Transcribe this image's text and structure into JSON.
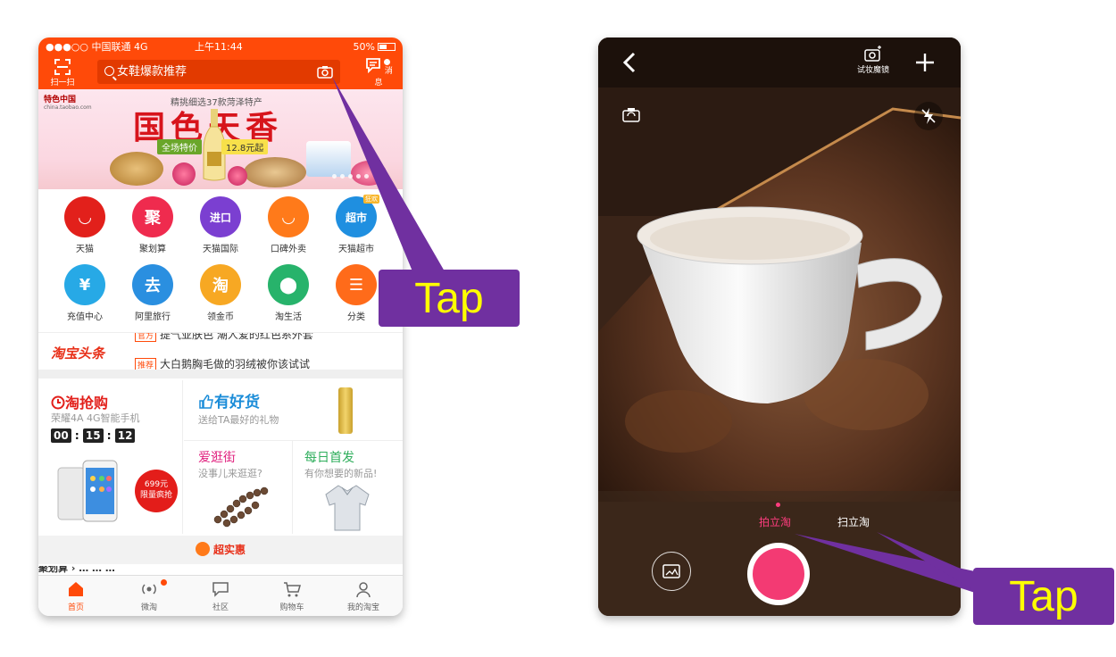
{
  "left_phone": {
    "status_bar": {
      "carrier": "●●●○○ 中国联通  4G",
      "time": "上午11:44",
      "battery": "50%"
    },
    "header": {
      "scan_label": "扫一扫",
      "search_placeholder": "女鞋爆款推荐",
      "messages_label": "消息"
    },
    "banner": {
      "brand": "特色中国",
      "top_text": "精挑细选37款菏泽特产",
      "title": "国色天香",
      "tag_left": "全场特价",
      "tag_right": "12.8元起"
    },
    "icons": [
      {
        "label": "天猫",
        "glyph": "◡",
        "color": "#e2201b",
        "icon": "tmall-icon"
      },
      {
        "label": "聚划算",
        "glyph": "聚",
        "color": "#ef2b4e",
        "icon": "juhuasuan-icon"
      },
      {
        "label": "天猫国际",
        "glyph": "进口",
        "color": "#7b3fd1",
        "icon": "tmall-global-icon"
      },
      {
        "label": "口碑外卖",
        "glyph": "◡",
        "color": "#ff7a1a",
        "icon": "koubei-icon"
      },
      {
        "label": "天猫超市",
        "glyph": "超市",
        "color": "#1f8fe0",
        "icon": "tmall-supermarket-icon",
        "badge": "狂欢"
      },
      {
        "label": "充值中心",
        "glyph": "¥",
        "color": "#27a9e6",
        "icon": "recharge-icon"
      },
      {
        "label": "阿里旅行",
        "glyph": "去",
        "color": "#2a8fe0",
        "icon": "travel-icon"
      },
      {
        "label": "领金币",
        "glyph": "淘",
        "color": "#f7a823",
        "icon": "gold-coin-icon"
      },
      {
        "label": "淘生活",
        "glyph": "⬤",
        "color": "#27b36b",
        "icon": "location-icon"
      },
      {
        "label": "分类",
        "glyph": "☰",
        "color": "#ff6b1a",
        "icon": "category-icon"
      }
    ],
    "headline": {
      "logo": "淘宝头条",
      "line1_tag": "官方",
      "line1": "提气亚肤色 潮人爱的红色系外套",
      "line2_tag": "推荐",
      "line2": "大白鹅胸毛做的羽绒被你该试试"
    },
    "flash_sale": {
      "title": "淘抢购",
      "subtitle": "荣耀4A   4G智能手机",
      "hours": "00",
      "minutes": "15",
      "seconds": "12",
      "sticker_price": "699元",
      "sticker_text": "限量疯抢"
    },
    "good_stuff": {
      "title": "有好货",
      "subtitle": "送给TA最好的礼物"
    },
    "love_street": {
      "title": "爱逛街",
      "subtitle": "没事儿来逛逛?"
    },
    "daily_first": {
      "title": "每日首发",
      "subtitle": "有你想要的新品!"
    },
    "deal_bar": "超实惠",
    "cut_row": "聚划算 ›        …         …         …",
    "tabs": [
      {
        "label": "首页",
        "icon": "home-icon"
      },
      {
        "label": "微淘",
        "icon": "broadcast-icon"
      },
      {
        "label": "社区",
        "icon": "chat-icon"
      },
      {
        "label": "购物车",
        "icon": "cart-icon"
      },
      {
        "label": "我的淘宝",
        "icon": "user-icon"
      }
    ]
  },
  "right_phone": {
    "makeup_label": "试妆魔镜",
    "mode_active": "拍立淘",
    "mode_inactive": "扫立淘"
  },
  "callouts": {
    "tap1": "Tap",
    "tap2": "Tap",
    "callout_color": "#7030a0",
    "text_color": "#ffff00"
  },
  "colors": {
    "taobao_orange": "#ff4a09",
    "shutter_pink": "#f33a73"
  }
}
